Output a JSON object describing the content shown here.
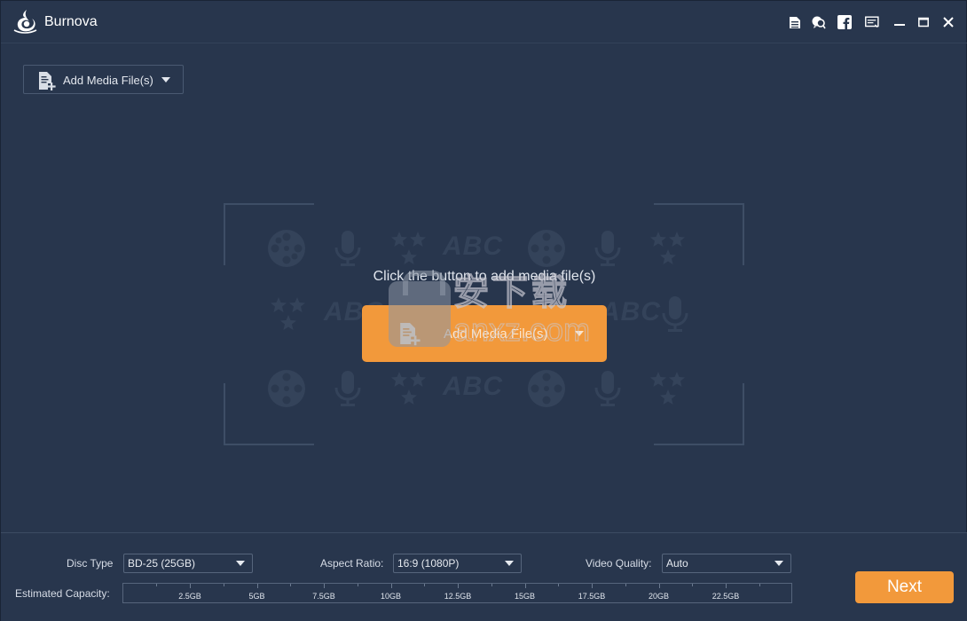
{
  "app": {
    "title": "Burnova"
  },
  "titlebar": {
    "icons": [
      "register-icon",
      "feedback-icon",
      "facebook-icon",
      "menu-icon",
      "minimize-icon",
      "maximize-icon",
      "close-icon"
    ]
  },
  "toolbar": {
    "add_media_label": "Add Media File(s)"
  },
  "drop_area": {
    "hint": "Click the button to add media file(s)",
    "add_button_label": "Add Media File(s)",
    "watermark_text": "ABC"
  },
  "watermark": {
    "line1": "安下载",
    "line2": "anxz.com"
  },
  "settings": {
    "disc_type": {
      "label": "Disc Type",
      "value": "BD-25 (25GB)"
    },
    "aspect_ratio": {
      "label": "Aspect Ratio:",
      "value": "16:9 (1080P)"
    },
    "video_quality": {
      "label": "Video Quality:",
      "value": "Auto"
    },
    "estimated_capacity": {
      "label": "Estimated Capacity:",
      "ticks": [
        "2.5GB",
        "5GB",
        "7.5GB",
        "10GB",
        "12.5GB",
        "15GB",
        "17.5GB",
        "20GB",
        "22.5GB"
      ],
      "used_fraction": 0
    }
  },
  "next_label": "Next",
  "colors": {
    "accent": "#f2993b",
    "background": "#28364d"
  }
}
